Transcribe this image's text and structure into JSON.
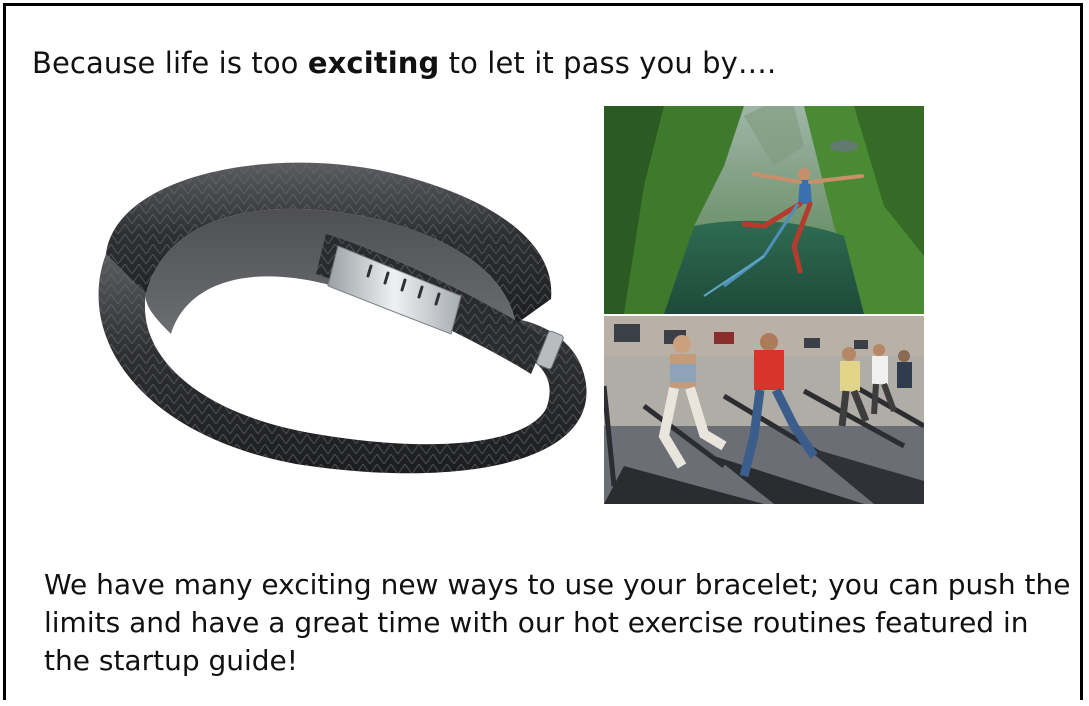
{
  "headline": {
    "before": "Because life is too ",
    "emphasis": "exciting",
    "after": " to let it pass you by…."
  },
  "body_text": "We have many exciting new ways to use your bracelet; you can push the limits and have a great time with our hot exercise routines featured in the startup guide!",
  "colors": {
    "band": "#2e2f31",
    "band_highlight": "#5a5c60",
    "metal_cap": "#cfd3d6",
    "valley_green": "#3f7a2c",
    "water": "#2f6b52",
    "gym_floor": "#6b6f75"
  }
}
